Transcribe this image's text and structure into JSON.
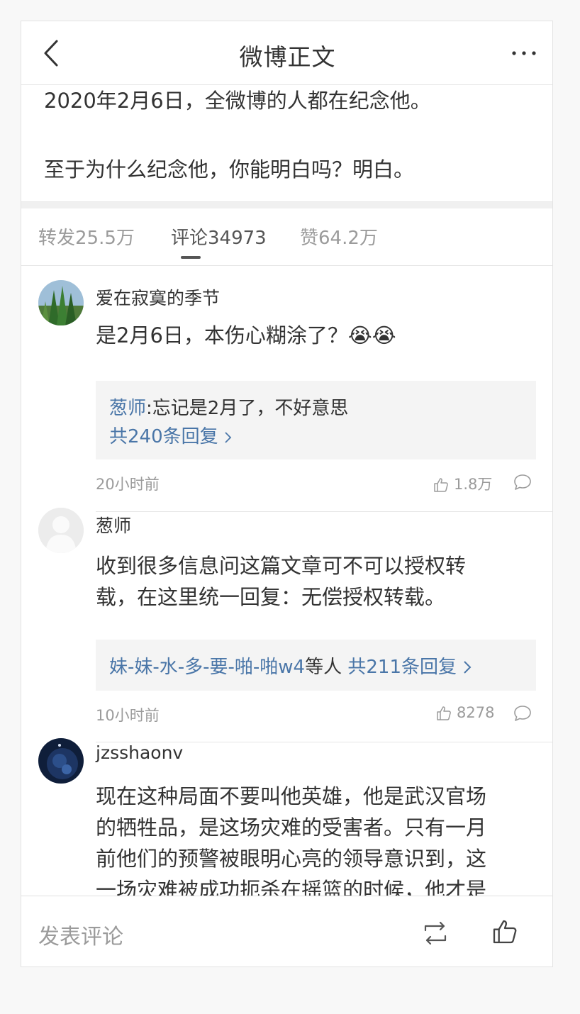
{
  "header": {
    "title": "微博正文"
  },
  "post": {
    "line1": "2020年2月6日，全微博的人都在纪念他。",
    "line2": "至于为什么纪念他，你能明白吗？明白。"
  },
  "tabs": [
    {
      "label": "转发25.5万",
      "active": false
    },
    {
      "label": "评论34973",
      "active": true
    },
    {
      "label": "赞64.2万",
      "active": false
    }
  ],
  "comments": [
    {
      "name": "爱在寂寞的季节",
      "text": "是2月6日，本伤心糊涂了？😭😭",
      "reply_user": "葱师",
      "reply_text": ":忘记是2月了，不好意思",
      "reply_count": "共240条回复",
      "time": "20小时前",
      "likes": "1.8万"
    },
    {
      "name": "葱师",
      "text_line1": "收到很多信息问这篇文章可不可以授权转",
      "text_line2": "载，在这里统一回复：无偿授权转载。",
      "reply_users": "妹-妹-水-多-要-啪-啪w4",
      "reply_mid": "等人",
      "reply_count": "共211条回复",
      "time": "10小时前",
      "likes": "8278"
    },
    {
      "name": "jzsshaonv",
      "text_line1": "现在这种局面不要叫他英雄，他是武汉官场",
      "text_line2": "的牺牲品，是这场灾难的受害者。只有一月",
      "text_line3": "前他们的预警被眼明心亮的领导意识到，这",
      "text_line4": "一场灾难被成功扼杀在摇篮的时候，他才是"
    }
  ],
  "bottom": {
    "compose_placeholder": "发表评论"
  },
  "icons": {
    "back": "chevron-left-icon",
    "more": "more-dots-icon",
    "thumb": "thumbs-up-icon",
    "reply": "speech-bubble-icon",
    "repost": "repost-icon"
  }
}
